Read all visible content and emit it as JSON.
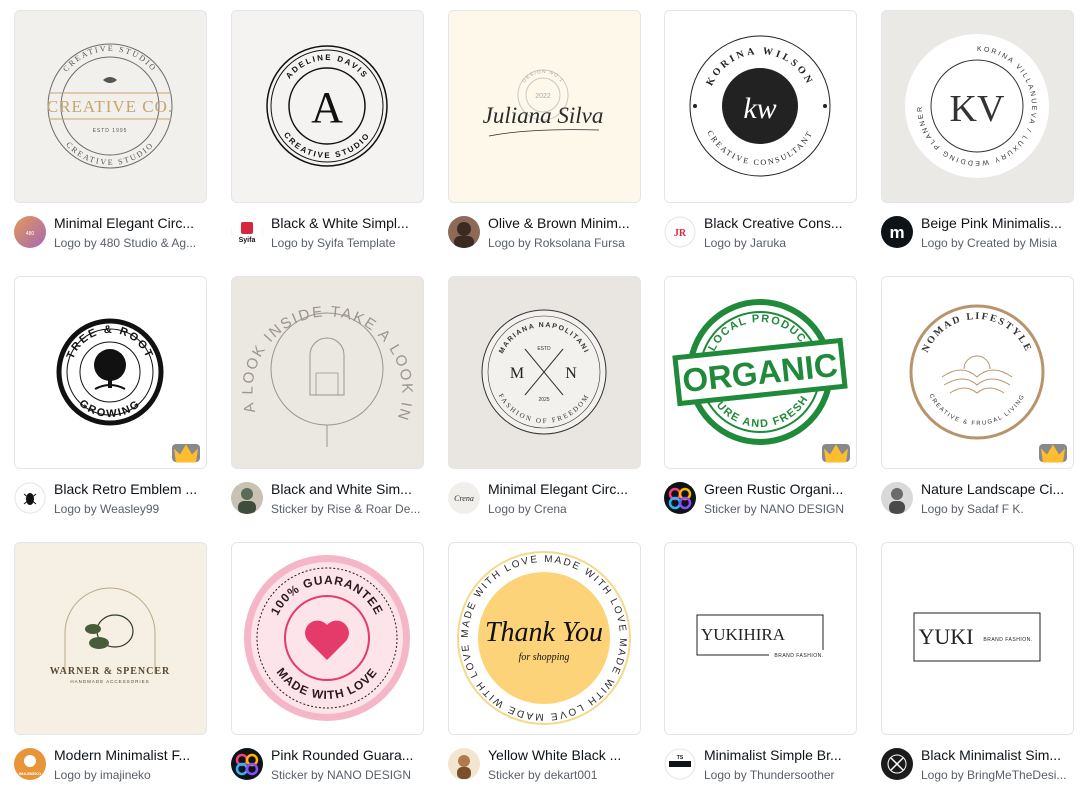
{
  "cards": [
    {
      "title": "Minimal Elegant Circ...",
      "byline": "Logo by 480 Studio & Ag...",
      "art": {
        "top": "CREATIVE STUDIO",
        "main": "CREATIVE CO.",
        "est": "ESTD 1995",
        "bottom": "CREATIVE STUDIO"
      },
      "avatar": {
        "kind": "gradient",
        "colors": [
          "#d88e5a",
          "#b36bb0"
        ]
      }
    },
    {
      "title": "Black & White Simpl...",
      "byline": "Logo by Syifa Template",
      "art": {
        "top": "ADELINE DAVIS",
        "main": "A",
        "bottom": "CREATIVE STUDIO"
      },
      "avatar": {
        "kind": "text",
        "text": "Syifa",
        "bg": "#ffffff",
        "fg": "#d7263d"
      }
    },
    {
      "title": "Olive & Brown Minim...",
      "byline": "Logo by Roksolana Fursa",
      "art": {
        "main": "Juliana Silva",
        "stamp": "2022",
        "stamp_ring": "DESIGN NO.1"
      },
      "avatar": {
        "kind": "photo",
        "colors": [
          "#3b2a22",
          "#8c6a55"
        ]
      }
    },
    {
      "title": "Black Creative Cons...",
      "byline": "Logo by Jaruka",
      "art": {
        "top": "KORINA WILSON",
        "main": "kw",
        "bottom": "CREATIVE CONSULTANT"
      },
      "avatar": {
        "kind": "text",
        "text": "JR",
        "bg": "#ffffff",
        "fg": "#d7263d"
      }
    },
    {
      "title": "Beige Pink Minimalis...",
      "byline": "Logo by Created by Misia",
      "art": {
        "ring": "KORINA VILLANUEVA / LUXURY WEDDING PLANNER",
        "main": "KV"
      },
      "avatar": {
        "kind": "text",
        "text": "m",
        "bg": "#0e1318",
        "fg": "#ffffff"
      }
    },
    {
      "title": "Black Retro Emblem ...",
      "byline": "Logo by Weasley99",
      "art": {
        "top": "TREE & ROOT",
        "bottom": "GROWING"
      },
      "avatar": {
        "kind": "icon",
        "bg": "#ffffff"
      },
      "premium": true
    },
    {
      "title": "Black and White Sim...",
      "byline": "Sticker by Rise & Roar De...",
      "art": {
        "ring": "TAKE A LOOK INSIDE TAKE A LOOK INSIDE"
      },
      "avatar": {
        "kind": "photo",
        "colors": [
          "#5b6b5a",
          "#c9c2b2"
        ]
      }
    },
    {
      "title": "Minimal Elegant Circ...",
      "byline": "Logo by Crena",
      "art": {
        "top": "MARIANA NAPOLITANI",
        "left": "M",
        "right": "N",
        "estd": "ESTD",
        "year": "2025",
        "bottom": "FASHION OF FREEDOM"
      },
      "avatar": {
        "kind": "text",
        "text": "Crena",
        "bg": "#f1efec",
        "fg": "#2b2b2b"
      }
    },
    {
      "title": "Green Rustic Organi...",
      "byline": "Sticker by NANO DESIGN",
      "art": {
        "top": "LOCAL PRODUCE",
        "main": "ORGANIC",
        "bottom": "PURE AND FRESH"
      },
      "avatar": {
        "kind": "nano",
        "bg": "#0e1318"
      },
      "premium": true
    },
    {
      "title": "Nature Landscape Ci...",
      "byline": "Logo by Sadaf F K.",
      "art": {
        "top": "NOMAD LIFESTYLE",
        "bottom": "CREATIVE & FRUGAL LIVING"
      },
      "avatar": {
        "kind": "photo",
        "colors": [
          "#d9d9d9",
          "#6b6b6b"
        ]
      },
      "premium": true
    },
    {
      "title": "Modern Minimalist F...",
      "byline": "Logo by imajineko",
      "art": {
        "main": "WARNER & SPENCER",
        "sub": "HANDMADE ACCESSORIES"
      },
      "avatar": {
        "kind": "text",
        "text": "IMAJINEKO",
        "bg": "#e8953a",
        "fg": "#ffffff"
      }
    },
    {
      "title": "Pink Rounded Guara...",
      "byline": "Sticker by NANO DESIGN",
      "art": {
        "top": "100% GUARANTEE",
        "bottom": "MADE WITH LOVE"
      },
      "avatar": {
        "kind": "nano",
        "bg": "#0e1318"
      }
    },
    {
      "title": "Yellow White Black ...",
      "byline": "Sticker by dekart001",
      "art": {
        "ring": "MADE WITH LOVE",
        "main": "Thank You",
        "sub": "for shopping"
      },
      "avatar": {
        "kind": "photo",
        "colors": [
          "#f3e6d0",
          "#b07a4a"
        ]
      }
    },
    {
      "title": "Minimalist Simple Br...",
      "byline": "Logo by Thundersoother",
      "art": {
        "main": "YUKIHIRA",
        "sub": "BRAND FASHION."
      },
      "avatar": {
        "kind": "text",
        "text": "TS",
        "bg": "#ffffff",
        "fg": "#0e1318"
      }
    },
    {
      "title": "Black Minimalist Sim...",
      "byline": "Logo by BringMeTheDesi...",
      "art": {
        "main": "YUKI",
        "sub": "BRAND FASHION."
      },
      "avatar": {
        "kind": "x",
        "bg": "#1b1b1b"
      }
    }
  ],
  "colors": {
    "accent_green": "#1f8a3a",
    "pink": "#f5b6c8",
    "heart": "#e43b6a",
    "yellow": "#fdd37a",
    "gold": "#b8946a"
  }
}
